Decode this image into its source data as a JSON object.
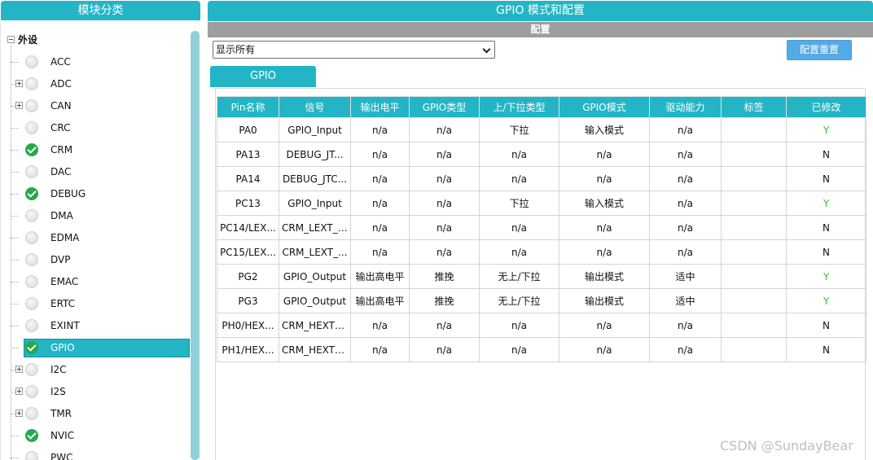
{
  "left_panel": {
    "title": "模块分类",
    "root_label": "外设",
    "items": [
      {
        "label": "ACC",
        "expand": false,
        "enabled": false,
        "selected": false
      },
      {
        "label": "ADC",
        "expand": true,
        "enabled": false,
        "selected": false
      },
      {
        "label": "CAN",
        "expand": true,
        "enabled": false,
        "selected": false
      },
      {
        "label": "CRC",
        "expand": false,
        "enabled": false,
        "selected": false
      },
      {
        "label": "CRM",
        "expand": false,
        "enabled": true,
        "selected": false
      },
      {
        "label": "DAC",
        "expand": false,
        "enabled": false,
        "selected": false
      },
      {
        "label": "DEBUG",
        "expand": false,
        "enabled": true,
        "selected": false
      },
      {
        "label": "DMA",
        "expand": false,
        "enabled": false,
        "selected": false
      },
      {
        "label": "EDMA",
        "expand": false,
        "enabled": false,
        "selected": false
      },
      {
        "label": "DVP",
        "expand": false,
        "enabled": false,
        "selected": false
      },
      {
        "label": "EMAC",
        "expand": false,
        "enabled": false,
        "selected": false
      },
      {
        "label": "ERTC",
        "expand": false,
        "enabled": false,
        "selected": false
      },
      {
        "label": "EXINT",
        "expand": false,
        "enabled": false,
        "selected": false
      },
      {
        "label": "GPIO",
        "expand": false,
        "enabled": true,
        "selected": true
      },
      {
        "label": "I2C",
        "expand": true,
        "enabled": false,
        "selected": false
      },
      {
        "label": "I2S",
        "expand": true,
        "enabled": false,
        "selected": false
      },
      {
        "label": "TMR",
        "expand": true,
        "enabled": false,
        "selected": false
      },
      {
        "label": "NVIC",
        "expand": false,
        "enabled": true,
        "selected": false
      },
      {
        "label": "PWC",
        "expand": false,
        "enabled": false,
        "selected": false
      }
    ]
  },
  "right_panel": {
    "title": "GPIO 模式和配置",
    "config_label": "配置",
    "filter_value": "显示所有",
    "reset_label": "配置重置",
    "tab_label": "GPIO",
    "columns": [
      "Pin名称",
      "信号",
      "输出电平",
      "GPIO类型",
      "上/下拉类型",
      "GPIO模式",
      "驱动能力",
      "标签",
      "已修改"
    ],
    "rows": [
      [
        "PA0",
        "GPIO_Input",
        "n/a",
        "n/a",
        "下拉",
        "输入模式",
        "n/a",
        "",
        "Y"
      ],
      [
        "PA13",
        "DEBUG_JT...",
        "n/a",
        "n/a",
        "n/a",
        "n/a",
        "n/a",
        "",
        "N"
      ],
      [
        "PA14",
        "DEBUG_JTC...",
        "n/a",
        "n/a",
        "n/a",
        "n/a",
        "n/a",
        "",
        "N"
      ],
      [
        "PC13",
        "GPIO_Input",
        "n/a",
        "n/a",
        "下拉",
        "输入模式",
        "n/a",
        "",
        "Y"
      ],
      [
        "PC14/LEX...",
        "CRM_LEXT_IN",
        "n/a",
        "n/a",
        "n/a",
        "n/a",
        "n/a",
        "",
        "N"
      ],
      [
        "PC15/LEX...",
        "CRM_LEXT_...",
        "n/a",
        "n/a",
        "n/a",
        "n/a",
        "n/a",
        "",
        "N"
      ],
      [
        "PG2",
        "GPIO_Output",
        "输出高电平",
        "推挽",
        "无上/下拉",
        "输出模式",
        "适中",
        "",
        "Y"
      ],
      [
        "PG3",
        "GPIO_Output",
        "输出高电平",
        "推挽",
        "无上/下拉",
        "输出模式",
        "适中",
        "",
        "Y"
      ],
      [
        "PH0/HEX...",
        "CRM_HEXT_...",
        "n/a",
        "n/a",
        "n/a",
        "n/a",
        "n/a",
        "",
        "N"
      ],
      [
        "PH1/HEX...",
        "CRM_HEXT_...",
        "n/a",
        "n/a",
        "n/a",
        "n/a",
        "n/a",
        "",
        "N"
      ]
    ]
  },
  "watermark": "CSDN @SundayBear",
  "colors": {
    "accent": "#23b5c5",
    "config_bar": "#9e9e9e",
    "button": "#55a9e6",
    "modified_yes": "#2fc62f",
    "enabled_status": "#27a84a"
  }
}
